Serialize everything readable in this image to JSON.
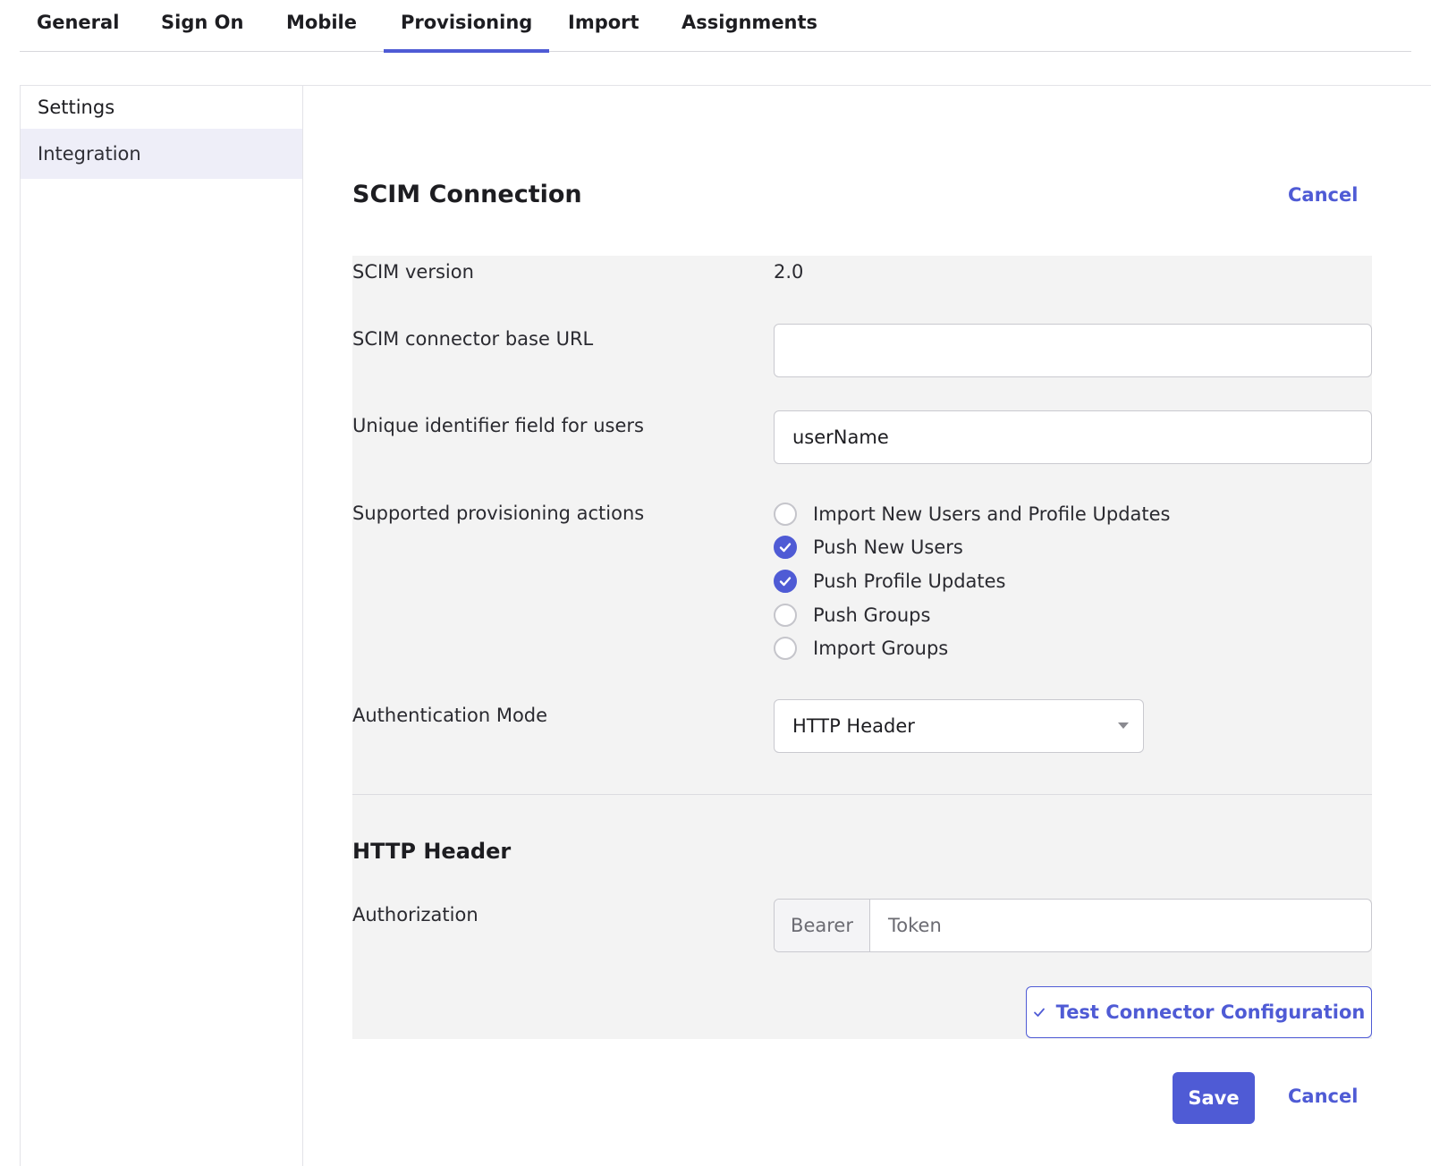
{
  "tabs": [
    {
      "label": "General"
    },
    {
      "label": "Sign On"
    },
    {
      "label": "Mobile"
    },
    {
      "label": "Provisioning",
      "active": true
    },
    {
      "label": "Import"
    },
    {
      "label": "Assignments"
    }
  ],
  "sidebar": {
    "heading": "Settings",
    "items": [
      {
        "label": "Integration",
        "selected": true
      }
    ]
  },
  "section": {
    "title": "SCIM Connection",
    "cancel_label": "Cancel"
  },
  "form": {
    "scim_version_label": "SCIM version",
    "scim_version_value": "2.0",
    "base_url_label": "SCIM connector base URL",
    "base_url_value": "",
    "unique_id_label": "Unique identifier field for users",
    "unique_id_value": "userName",
    "actions_label": "Supported provisioning actions",
    "actions": [
      {
        "label": "Import New Users and Profile Updates",
        "checked": false
      },
      {
        "label": "Push New Users",
        "checked": true
      },
      {
        "label": "Push Profile Updates",
        "checked": true
      },
      {
        "label": "Push Groups",
        "checked": false
      },
      {
        "label": "Import Groups",
        "checked": false
      }
    ],
    "auth_mode_label": "Authentication Mode",
    "auth_mode_value": "HTTP Header"
  },
  "http_header": {
    "title": "HTTP Header",
    "authorization_label": "Authorization",
    "prefix": "Bearer",
    "token_placeholder": "Token",
    "test_button_label": "Test Connector Configuration"
  },
  "footer": {
    "save_label": "Save",
    "cancel_label": "Cancel"
  },
  "colors": {
    "accent": "#4f5bd5",
    "form_background": "#f3f3f3",
    "selected_nav_background": "#eeeef8"
  }
}
